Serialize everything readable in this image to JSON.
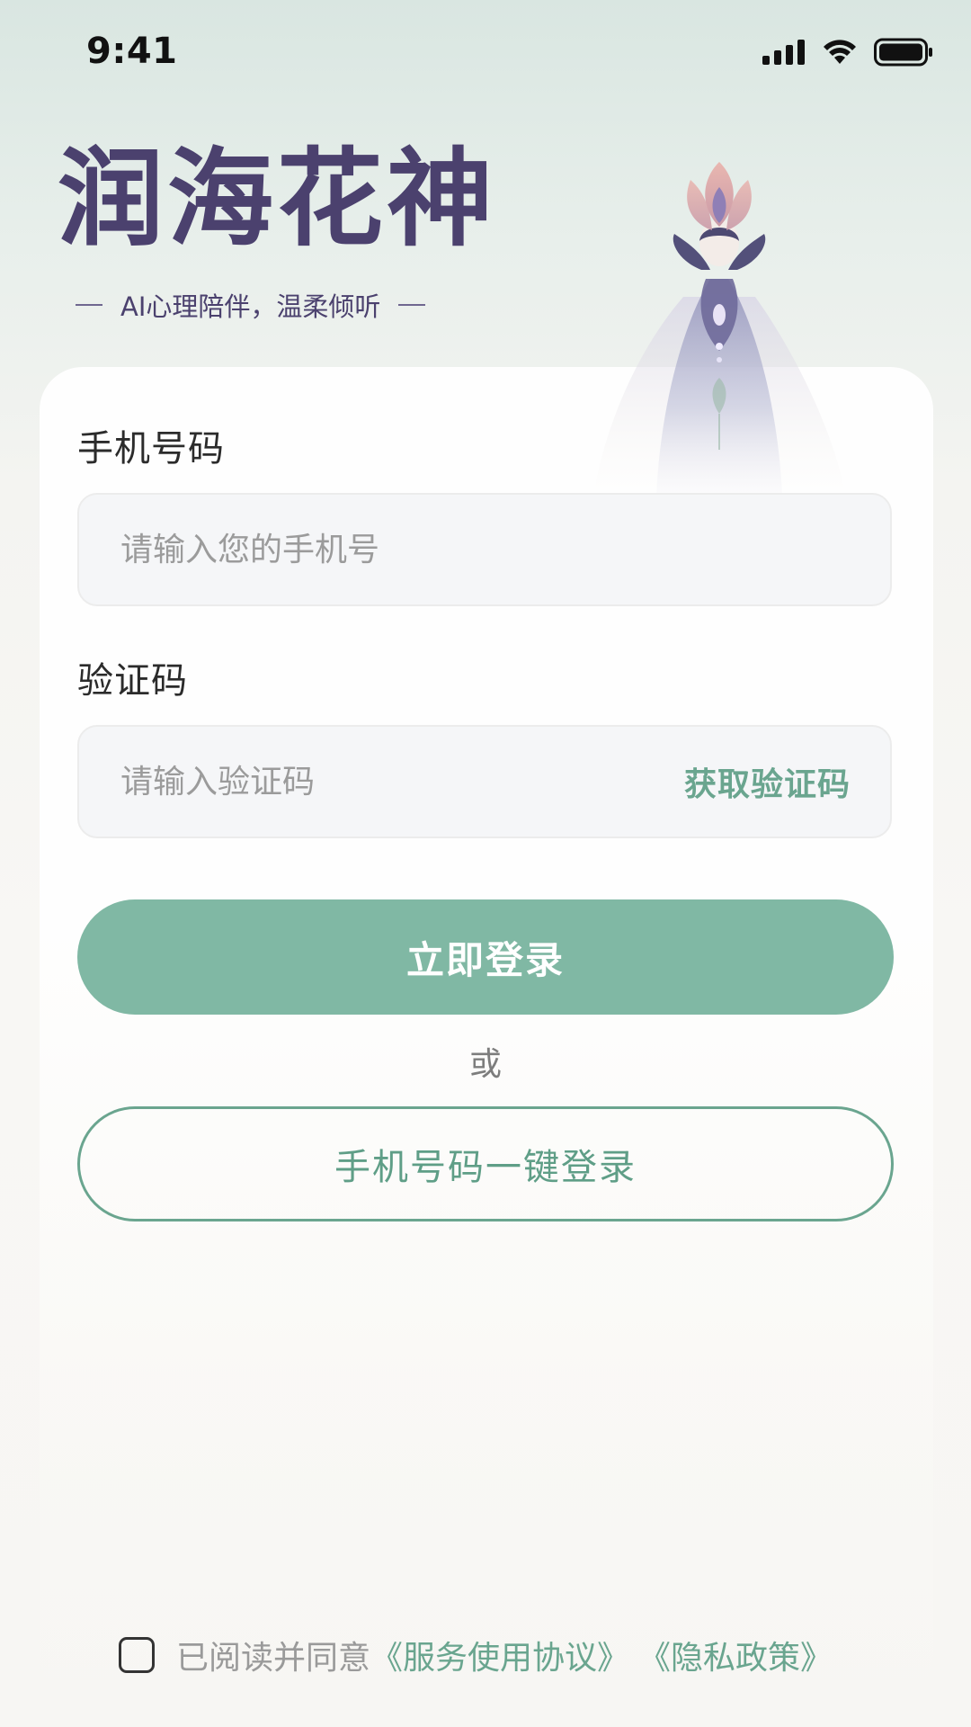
{
  "status_bar": {
    "time": "9:41",
    "icons": [
      "signal-icon",
      "wifi-icon",
      "battery-icon"
    ]
  },
  "brand": {
    "title": "润海花神",
    "subtitle": "AI心理陪伴，温柔倾听",
    "illustration": "flower-spirit-illustration"
  },
  "form": {
    "phone_label": "手机号码",
    "phone_placeholder": "请输入您的手机号",
    "phone_value": "",
    "code_label": "验证码",
    "code_placeholder": "请输入验证码",
    "code_value": "",
    "get_code_label": "获取验证码"
  },
  "actions": {
    "login_label": "立即登录",
    "or_text": "或",
    "one_click_label": "手机号码一键登录"
  },
  "agreement": {
    "checked": false,
    "prefix": "已阅读并同意",
    "terms_link": "《服务使用协议》",
    "privacy_link": "《隐私政策》"
  },
  "colors": {
    "brand_purple": "#4b416e",
    "accent_green": "#80b8a4",
    "link_green": "#6aa58f",
    "input_bg": "#f5f6f8"
  }
}
